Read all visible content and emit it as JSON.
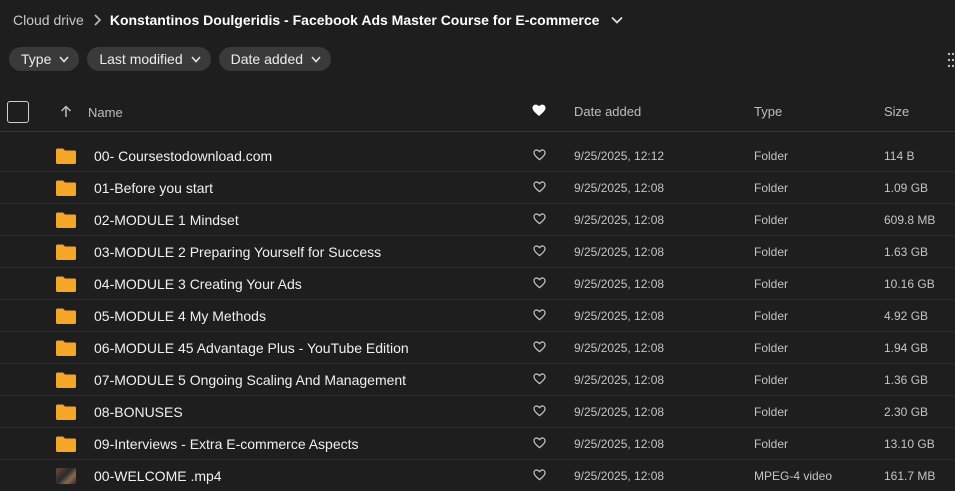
{
  "breadcrumb": {
    "root": "Cloud drive",
    "current": "Konstantinos Doulgeridis - Facebook Ads Master Course for E-commerce"
  },
  "filters": [
    {
      "label": "Type"
    },
    {
      "label": "Last modified"
    },
    {
      "label": "Date added"
    }
  ],
  "columns": {
    "name": "Name",
    "date_added": "Date added",
    "type": "Type",
    "size": "Size"
  },
  "colors": {
    "background": "#1e1e1e",
    "folder": "#f5a623",
    "chip": "#3a3a3a"
  },
  "rows": [
    {
      "icon": "folder-icon",
      "name": "00- Coursestodownload.com",
      "date": "9/25/2025, 12:12",
      "type": "Folder",
      "size": "114 B"
    },
    {
      "icon": "folder-icon",
      "name": "01-Before you start",
      "date": "9/25/2025, 12:08",
      "type": "Folder",
      "size": "1.09 GB"
    },
    {
      "icon": "folder-icon",
      "name": "02-MODULE 1 Mindset",
      "date": "9/25/2025, 12:08",
      "type": "Folder",
      "size": "609.8 MB"
    },
    {
      "icon": "folder-icon",
      "name": "03-MODULE 2 Preparing Yourself for Success",
      "date": "9/25/2025, 12:08",
      "type": "Folder",
      "size": "1.63 GB"
    },
    {
      "icon": "folder-icon",
      "name": "04-MODULE 3 Creating Your Ads",
      "date": "9/25/2025, 12:08",
      "type": "Folder",
      "size": "10.16 GB"
    },
    {
      "icon": "folder-icon",
      "name": "05-MODULE 4 My Methods",
      "date": "9/25/2025, 12:08",
      "type": "Folder",
      "size": "4.92 GB"
    },
    {
      "icon": "folder-icon",
      "name": "06-MODULE 45 Advantage Plus - YouTube Edition",
      "date": "9/25/2025, 12:08",
      "type": "Folder",
      "size": "1.94 GB"
    },
    {
      "icon": "folder-icon",
      "name": "07-MODULE 5 Ongoing Scaling And Management",
      "date": "9/25/2025, 12:08",
      "type": "Folder",
      "size": "1.36 GB"
    },
    {
      "icon": "folder-icon",
      "name": "08-BONUSES",
      "date": "9/25/2025, 12:08",
      "type": "Folder",
      "size": "2.30 GB"
    },
    {
      "icon": "folder-icon",
      "name": "09-Interviews - Extra E-commerce Aspects",
      "date": "9/25/2025, 12:08",
      "type": "Folder",
      "size": "13.10 GB"
    },
    {
      "icon": "video-thumbnail",
      "name": "00-WELCOME .mp4",
      "date": "9/25/2025, 12:08",
      "type": "MPEG-4 video",
      "size": "161.7 MB"
    }
  ]
}
